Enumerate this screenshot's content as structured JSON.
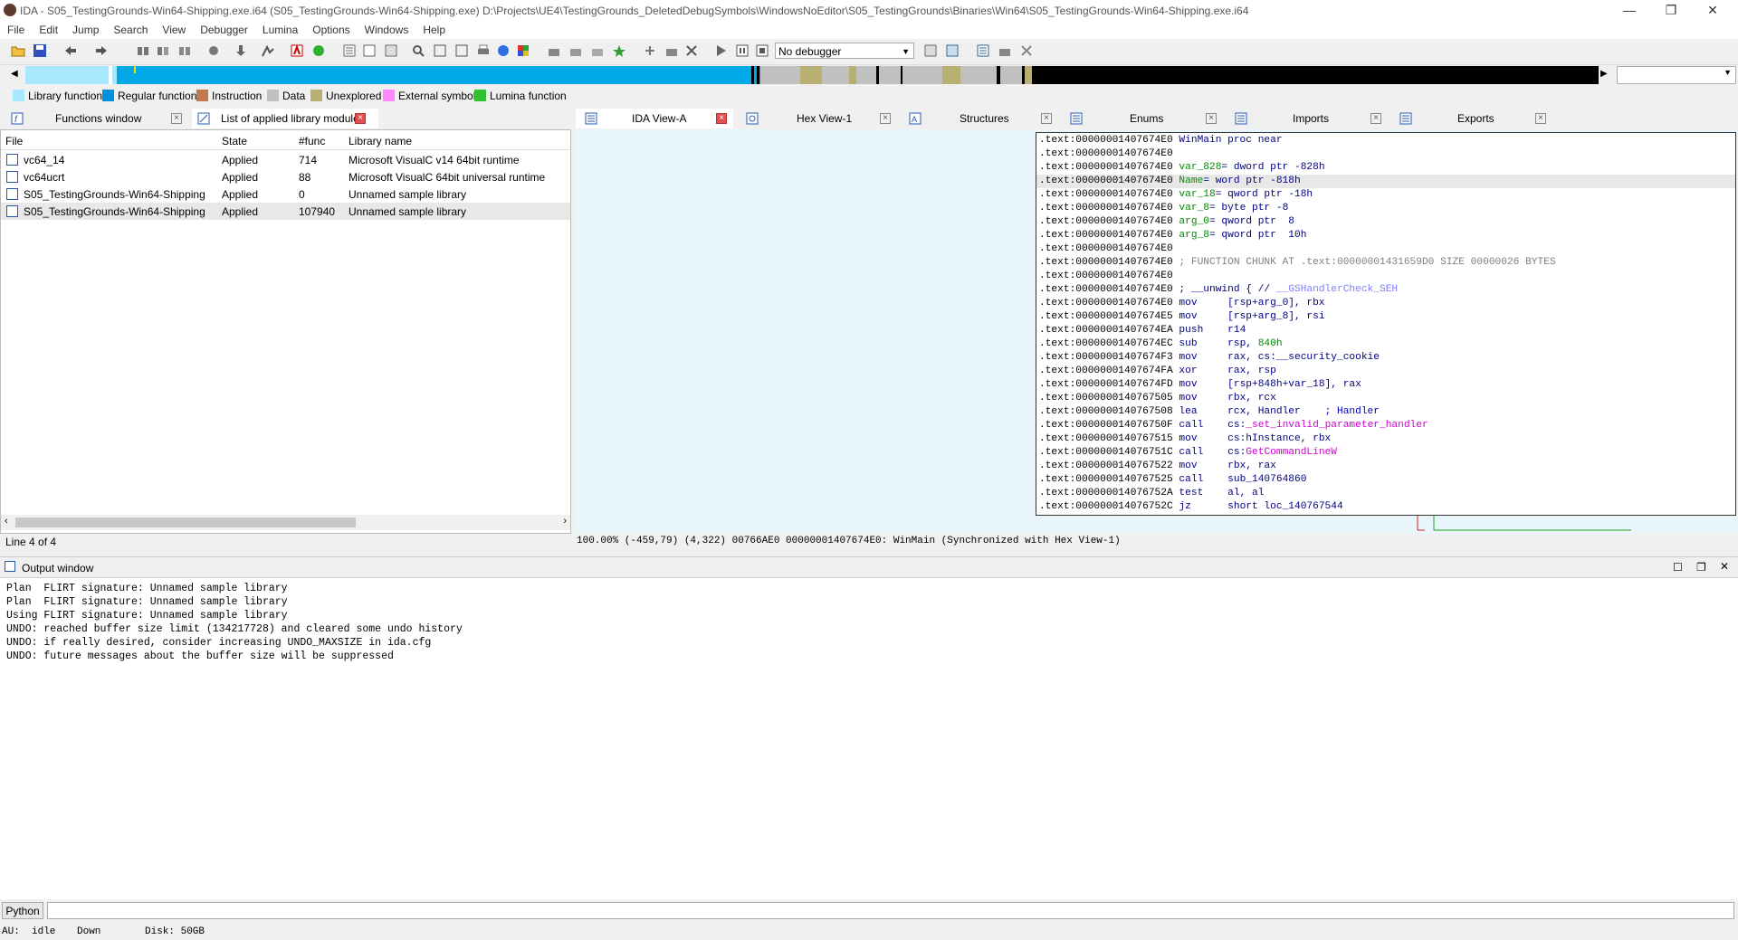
{
  "window": {
    "title": "IDA - S05_TestingGrounds-Win64-Shipping.exe.i64 (S05_TestingGrounds-Win64-Shipping.exe) D:\\Projects\\UE4\\TestingGrounds_DeletedDebugSymbols\\WindowsNoEditor\\S05_TestingGrounds\\Binaries\\Win64\\S05_TestingGrounds-Win64-Shipping.exe.i64",
    "minimize": "—",
    "restore": "❐",
    "close": "✕"
  },
  "menu": [
    "File",
    "Edit",
    "Jump",
    "Search",
    "View",
    "Debugger",
    "Lumina",
    "Options",
    "Windows",
    "Help"
  ],
  "toolbar": {
    "debugger_value": "No debugger"
  },
  "legend": [
    {
      "label": "Library function",
      "color": "#a8e8ff"
    },
    {
      "label": "Regular function",
      "color": "#0090e0"
    },
    {
      "label": "Instruction",
      "color": "#c07850"
    },
    {
      "label": "Data",
      "color": "#c0c0c0"
    },
    {
      "label": "Unexplored",
      "color": "#b8b070"
    },
    {
      "label": "External symbol",
      "color": "#ff88ff"
    },
    {
      "label": "Lumina function",
      "color": "#30c030"
    }
  ],
  "left_tabs": {
    "functions": "Functions window",
    "libs": "List of applied library modules"
  },
  "right_tabs": {
    "ida_view": "IDA View-A",
    "hex_view": "Hex View-1",
    "structures": "Structures",
    "enums": "Enums",
    "imports": "Imports",
    "exports": "Exports"
  },
  "library_table": {
    "headers": {
      "file": "File",
      "state": "State",
      "func": "#func",
      "name": "Library name"
    },
    "rows": [
      {
        "file": "vc64_14",
        "state": "Applied",
        "func": "714",
        "name": "Microsoft VisualC v14 64bit runtime"
      },
      {
        "file": "vc64ucrt",
        "state": "Applied",
        "func": "88",
        "name": "Microsoft VisualC 64bit universal runtime"
      },
      {
        "file": "S05_TestingGrounds-Win64-Shipping",
        "state": "Applied",
        "func": "0",
        "name": "Unnamed sample library"
      },
      {
        "file": "S05_TestingGrounds-Win64-Shipping",
        "state": "Applied",
        "func": "107940",
        "name": "Unnamed sample library"
      }
    ],
    "status": "Line 4 of 4"
  },
  "disasm": [
    {
      "addr": ".text:00000001407674E0",
      "c1": "WinMain proc near",
      "c1c": "c-navy",
      "c2": "",
      "c2c": "",
      "c3": "",
      "c3c": ""
    },
    {
      "addr": ".text:00000001407674E0",
      "c1": "",
      "c1c": "",
      "c2": "",
      "c2c": "",
      "c3": "",
      "c3c": ""
    },
    {
      "addr": ".text:00000001407674E0",
      "c1": "var_828",
      "c1c": "c-green",
      "c2": "= dword ptr -828h",
      "c2c": "c-navy",
      "c3": "",
      "c3c": ""
    },
    {
      "addr": ".text:00000001407674E0",
      "c1": "Name",
      "c1c": "c-green",
      "c2": "= word ptr -818h",
      "c2c": "c-navy",
      "c3": "",
      "c3c": "",
      "hl": true
    },
    {
      "addr": ".text:00000001407674E0",
      "c1": "var_18",
      "c1c": "c-green",
      "c2": "= qword ptr -18h",
      "c2c": "c-navy",
      "c3": "",
      "c3c": ""
    },
    {
      "addr": ".text:00000001407674E0",
      "c1": "var_8",
      "c1c": "c-green",
      "c2": "= byte ptr -8",
      "c2c": "c-navy",
      "c3": "",
      "c3c": ""
    },
    {
      "addr": ".text:00000001407674E0",
      "c1": "arg_0",
      "c1c": "c-green",
      "c2": "= qword ptr  8",
      "c2c": "c-navy",
      "c3": "",
      "c3c": ""
    },
    {
      "addr": ".text:00000001407674E0",
      "c1": "arg_8",
      "c1c": "c-green",
      "c2": "= qword ptr  10h",
      "c2c": "c-navy",
      "c3": "",
      "c3c": ""
    },
    {
      "addr": ".text:00000001407674E0",
      "c1": "",
      "c1c": "",
      "c2": "",
      "c2c": "",
      "c3": "",
      "c3c": ""
    },
    {
      "addr": ".text:00000001407674E0",
      "c1": "; FUNCTION CHUNK AT .text:00000001431659D0 SIZE 00000026 BYTES",
      "c1c": "c-gray",
      "c2": "",
      "c2c": "",
      "c3": "",
      "c3c": ""
    },
    {
      "addr": ".text:00000001407674E0",
      "c1": "",
      "c1c": "",
      "c2": "",
      "c2c": "",
      "c3": "",
      "c3c": ""
    },
    {
      "addr": ".text:00000001407674E0",
      "c1": "; __unwind { // ",
      "c1c": "c-navy",
      "c2": "__GSHandlerCheck_SEH",
      "c2c": "c-purple",
      "c3": "",
      "c3c": ""
    },
    {
      "addr": ".text:00000001407674E0",
      "c1": "mov     ",
      "c1c": "c-navy",
      "c2": "[rsp+arg_0], rbx",
      "c2c": "c-navy",
      "c3": "",
      "c3c": ""
    },
    {
      "addr": ".text:00000001407674E5",
      "c1": "mov     ",
      "c1c": "c-navy",
      "c2": "[rsp+arg_8], rsi",
      "c2c": "c-navy",
      "c3": "",
      "c3c": ""
    },
    {
      "addr": ".text:00000001407674EA",
      "c1": "push    ",
      "c1c": "c-navy",
      "c2": "r14",
      "c2c": "c-navy",
      "c3": "",
      "c3c": ""
    },
    {
      "addr": ".text:00000001407674EC",
      "c1": "sub     ",
      "c1c": "c-navy",
      "c2": "rsp, ",
      "c2c": "c-navy",
      "c3": "840h",
      "c3c": "c-green"
    },
    {
      "addr": ".text:00000001407674F3",
      "c1": "mov     ",
      "c1c": "c-navy",
      "c2": "rax, cs:__security_cookie",
      "c2c": "c-navy",
      "c3": "",
      "c3c": ""
    },
    {
      "addr": ".text:00000001407674FA",
      "c1": "xor     ",
      "c1c": "c-navy",
      "c2": "rax, rsp",
      "c2c": "c-navy",
      "c3": "",
      "c3c": ""
    },
    {
      "addr": ".text:00000001407674FD",
      "c1": "mov     ",
      "c1c": "c-navy",
      "c2": "[rsp+848h+var_18], rax",
      "c2c": "c-navy",
      "c3": "",
      "c3c": ""
    },
    {
      "addr": ".text:0000000140767505",
      "c1": "mov     ",
      "c1c": "c-navy",
      "c2": "rbx, rcx",
      "c2c": "c-navy",
      "c3": "",
      "c3c": ""
    },
    {
      "addr": ".text:0000000140767508",
      "c1": "lea     ",
      "c1c": "c-navy",
      "c2": "rcx, Handler    ",
      "c2c": "c-navy",
      "c3": "; Handler",
      "c3c": "c-blue"
    },
    {
      "addr": ".text:000000014076750F",
      "c1": "call    ",
      "c1c": "c-navy",
      "c2": "cs:",
      "c2c": "c-navy",
      "c3": "_set_invalid_parameter_handler",
      "c3c": "c-pink"
    },
    {
      "addr": ".text:0000000140767515",
      "c1": "mov     ",
      "c1c": "c-navy",
      "c2": "cs:hInstance, rbx",
      "c2c": "c-navy",
      "c3": "",
      "c3c": ""
    },
    {
      "addr": ".text:000000014076751C",
      "c1": "call    ",
      "c1c": "c-navy",
      "c2": "cs:",
      "c2c": "c-navy",
      "c3": "GetCommandLineW",
      "c3c": "c-pink"
    },
    {
      "addr": ".text:0000000140767522",
      "c1": "mov     ",
      "c1c": "c-navy",
      "c2": "rbx, rax",
      "c2c": "c-navy",
      "c3": "",
      "c3c": ""
    },
    {
      "addr": ".text:0000000140767525",
      "c1": "call    ",
      "c1c": "c-navy",
      "c2": "sub_140764860",
      "c2c": "c-navy",
      "c3": "",
      "c3c": ""
    },
    {
      "addr": ".text:000000014076752A",
      "c1": "test    ",
      "c1c": "c-navy",
      "c2": "al, al",
      "c2c": "c-navy",
      "c3": "",
      "c3c": ""
    },
    {
      "addr": ".text:000000014076752C",
      "c1": "jz      ",
      "c1c": "c-navy",
      "c2": "short loc_140767544",
      "c2c": "c-navy",
      "c3": "",
      "c3c": ""
    }
  ],
  "ida_status": "100.00% (-459,79) (4,322) 00766AE0 00000001407674E0: WinMain (Synchronized with Hex View-1)",
  "output": {
    "title": "Output window",
    "lines": [
      "Plan  FLIRT signature: Unnamed sample library",
      "Plan  FLIRT signature: Unnamed sample library",
      "Using FLIRT signature: Unnamed sample library",
      "UNDO: reached buffer size limit (134217728) and cleared some undo history",
      "UNDO: if really desired, consider increasing UNDO_MAXSIZE in ida.cfg",
      "UNDO: future messages about the buffer size will be suppressed"
    ]
  },
  "python_button": "Python",
  "statusbar": {
    "au": "AU:  idle",
    "dir": "Down",
    "disk": "Disk: 50GB"
  },
  "icons": [
    "open-icon",
    "save-icon",
    "back-icon",
    "forward-icon",
    "run-icon",
    "pause-icon",
    "stop-icon",
    "function-icon",
    "library-icon",
    "view-icon",
    "hex-icon",
    "struct-icon",
    "enum-icon",
    "import-icon",
    "export-icon"
  ]
}
